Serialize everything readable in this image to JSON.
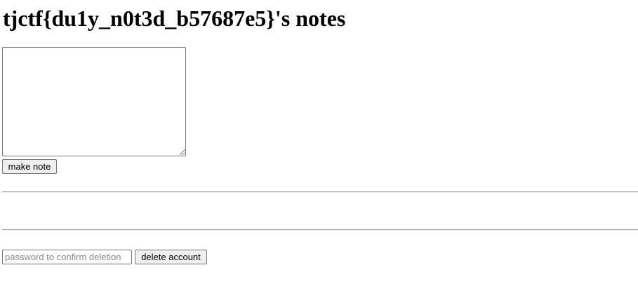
{
  "header": {
    "title": "tjctf{du1y_n0t3d_b57687e5}'s notes"
  },
  "note_form": {
    "textarea_value": "",
    "submit_label": "make note"
  },
  "notes_list": [],
  "delete_form": {
    "password_placeholder": "password to confirm deletion",
    "password_value": "",
    "submit_label": "delete account"
  }
}
